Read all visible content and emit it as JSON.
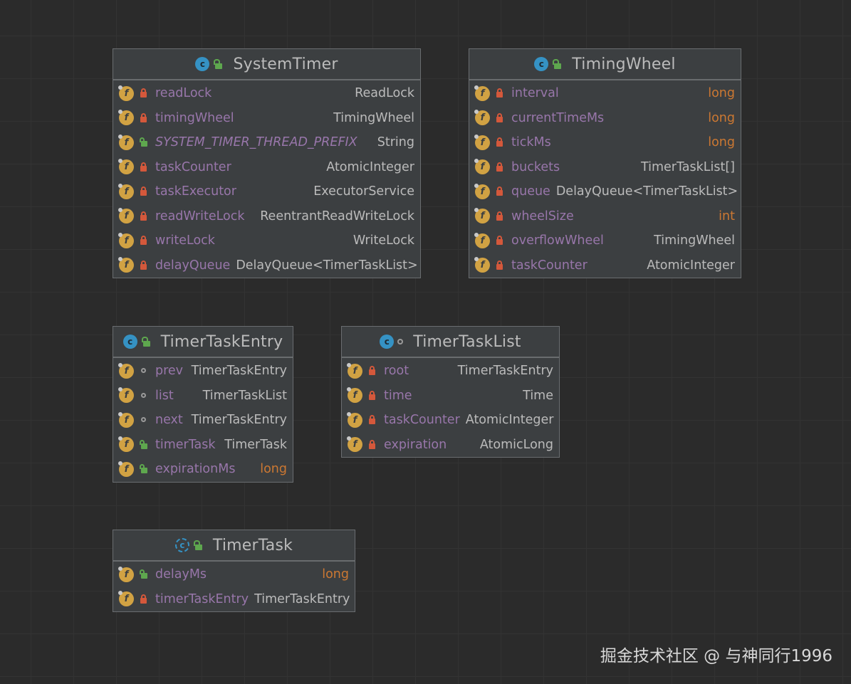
{
  "classes": {
    "system_timer": {
      "name": "SystemTimer",
      "fields": [
        {
          "name": "readLock",
          "type": "ReadLock"
        },
        {
          "name": "timingWheel",
          "type": "TimingWheel"
        },
        {
          "name": "SYSTEM_TIMER_THREAD_PREFIX",
          "type": "String"
        },
        {
          "name": "taskCounter",
          "type": "AtomicInteger"
        },
        {
          "name": "taskExecutor",
          "type": "ExecutorService"
        },
        {
          "name": "readWriteLock",
          "type": "ReentrantReadWriteLock"
        },
        {
          "name": "writeLock",
          "type": "WriteLock"
        },
        {
          "name": "delayQueue",
          "type": "DelayQueue<TimerTaskList>"
        }
      ]
    },
    "timing_wheel": {
      "name": "TimingWheel",
      "fields": [
        {
          "name": "interval",
          "type": "long"
        },
        {
          "name": "currentTimeMs",
          "type": "long"
        },
        {
          "name": "tickMs",
          "type": "long"
        },
        {
          "name": "buckets",
          "type": "TimerTaskList[]"
        },
        {
          "name": "queue",
          "type": "DelayQueue<TimerTaskList>"
        },
        {
          "name": "wheelSize",
          "type": "int"
        },
        {
          "name": "overflowWheel",
          "type": "TimingWheel"
        },
        {
          "name": "taskCounter",
          "type": "AtomicInteger"
        }
      ]
    },
    "timer_task_entry": {
      "name": "TimerTaskEntry",
      "fields": [
        {
          "name": "prev",
          "type": "TimerTaskEntry"
        },
        {
          "name": "list",
          "type": "TimerTaskList"
        },
        {
          "name": "next",
          "type": "TimerTaskEntry"
        },
        {
          "name": "timerTask",
          "type": "TimerTask"
        },
        {
          "name": "expirationMs",
          "type": "long"
        }
      ]
    },
    "timer_task_list": {
      "name": "TimerTaskList",
      "fields": [
        {
          "name": "root",
          "type": "TimerTaskEntry"
        },
        {
          "name": "time",
          "type": "Time"
        },
        {
          "name": "taskCounter",
          "type": "AtomicInteger"
        },
        {
          "name": "expiration",
          "type": "AtomicLong"
        }
      ]
    },
    "timer_task": {
      "name": "TimerTask",
      "fields": [
        {
          "name": "delayMs",
          "type": "long"
        },
        {
          "name": "timerTaskEntry",
          "type": "TimerTaskEntry"
        }
      ]
    }
  },
  "icons": {
    "class_letter": "c",
    "field_letter": "f"
  },
  "colors": {
    "background": "#2b2b2b",
    "field_name": "#9876aa",
    "type_text": "#bbbbbb",
    "primitive_type": "#cc7832",
    "field_icon": "#d1a243",
    "class_icon": "#3592c4",
    "private_lock": "#d4583b",
    "public_lock": "#5ea74e"
  },
  "watermark": "掘金技术社区 @ 与神同行1996"
}
